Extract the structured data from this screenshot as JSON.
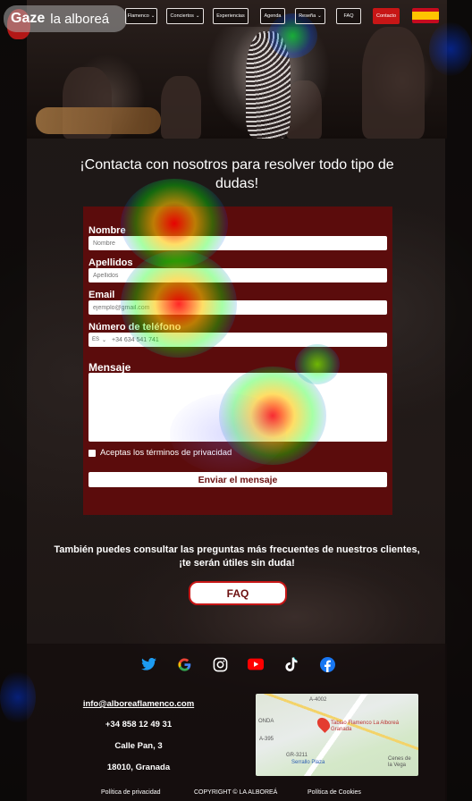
{
  "overlay": {
    "logo_text": "Gaze",
    "logo_site": "la alboreá"
  },
  "nav": {
    "items": [
      {
        "label": "Flamenco",
        "chevron": "⌄",
        "active": false
      },
      {
        "label": "Conciertos",
        "chevron": "⌄",
        "active": false
      },
      {
        "label": "Experiencias",
        "chevron": "",
        "active": false
      },
      {
        "label": "Agenda",
        "chevron": "",
        "active": false
      },
      {
        "label": "Reseña",
        "chevron": "⌄",
        "active": false
      },
      {
        "label": "FAQ",
        "chevron": "",
        "active": false
      },
      {
        "label": "Contacto",
        "chevron": "",
        "active": true
      }
    ],
    "language_flag": "spain-flag-icon"
  },
  "contact": {
    "title": "¡Contacta con nosotros para resolver todo tipo de dudas!",
    "name_label": "Nombre",
    "name_placeholder": "Nombre",
    "surname_label": "Apellidos",
    "surname_placeholder": "Apellidos",
    "email_label": "Email",
    "email_placeholder": "ejemplo@gmail.com",
    "phone_label": "Número de teléfono",
    "phone_country": "ES",
    "phone_placeholder": "+34 634 541 741",
    "message_label": "Mensaje",
    "terms_label": "Aceptas los términos de privacidad",
    "send_label": "Enviar el mensaje"
  },
  "faq": {
    "text_line1": "También puedes consultar las preguntas más frecuentes de nuestros clientes,",
    "text_line2": "¡te serán útiles sin duda!",
    "button_label": "FAQ"
  },
  "footer": {
    "social_icons": [
      "twitter-icon",
      "google-icon",
      "instagram-icon",
      "youtube-icon",
      "tiktok-icon",
      "facebook-icon"
    ],
    "email": "info@alboreaflamenco.com",
    "phone": "+34 858 12 49 31",
    "street": "Calle Pan, 3",
    "city": "18010, Granada",
    "map_place": "Tablao Flamenco La Alboreá Granada",
    "map_labels": [
      "A-4002",
      "ONDA",
      "GR-3211",
      "Serrallo Plaza",
      "Cenes de la Vega",
      "A-395"
    ],
    "privacy_link": "Política de privacidad",
    "copyright": "COPYRIGHT © LA ALBOREÁ",
    "cookies_link": "Política de Cookies"
  },
  "colors": {
    "accent_red": "#c71616",
    "panel_red": "#5b0c0c",
    "button_text": "#6c1010"
  }
}
